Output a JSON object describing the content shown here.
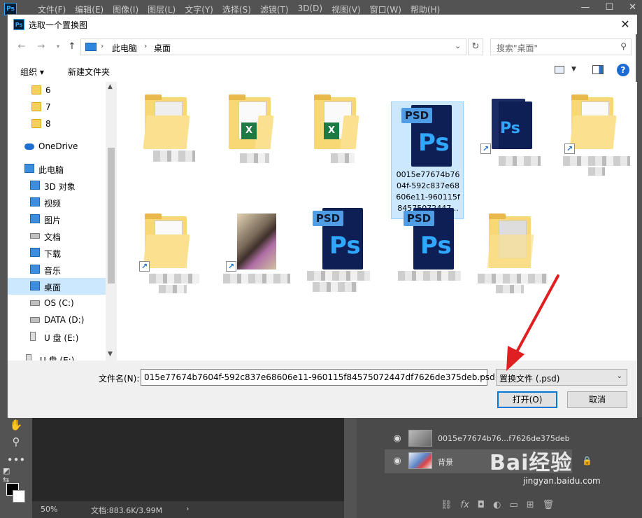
{
  "ps": {
    "logo": "Ps",
    "menu": [
      "文件(F)",
      "编辑(E)",
      "图像(I)",
      "图层(L)",
      "文字(Y)",
      "选择(S)",
      "滤镜(T)",
      "3D(D)",
      "视图(V)",
      "窗口(W)",
      "帮助(H)"
    ],
    "status": {
      "zoom": "50%",
      "doc": "文档:883.6K/3.99M",
      "arrow": "›"
    },
    "layers": [
      {
        "name": "0015e77674b76...f7626de375deb"
      },
      {
        "name": "背景"
      }
    ]
  },
  "dialog": {
    "title": "选取一个置换图",
    "close": "✕",
    "breadcrumb": [
      "此电脑",
      "桌面"
    ],
    "search_placeholder": "搜索\"桌面\"",
    "toolbar": {
      "organize": "组织 ▾",
      "new_folder": "新建文件夹",
      "help": "?"
    },
    "nav_items": [
      {
        "label": "6",
        "icon": "folder-icon"
      },
      {
        "label": "7",
        "icon": "folder-icon"
      },
      {
        "label": "8",
        "icon": "folder-icon"
      },
      {
        "label": "OneDrive",
        "icon": "cloud-icon"
      },
      {
        "label": "此电脑",
        "icon": "computer-icon"
      },
      {
        "label": "3D 对象",
        "icon": "3d-objects-icon"
      },
      {
        "label": "视频",
        "icon": "video-icon"
      },
      {
        "label": "图片",
        "icon": "pictures-icon"
      },
      {
        "label": "文档",
        "icon": "documents-icon"
      },
      {
        "label": "下载",
        "icon": "download-icon"
      },
      {
        "label": "音乐",
        "icon": "music-icon"
      },
      {
        "label": "桌面",
        "icon": "desktop-icon"
      },
      {
        "label": "OS (C:)",
        "icon": "drive-icon"
      },
      {
        "label": "DATA (D:)",
        "icon": "drive-icon"
      },
      {
        "label": "U 盘 (E:)",
        "icon": "usb-drive-icon"
      },
      {
        "label": "U 盘 (E:)",
        "icon": "usb-drive-icon"
      }
    ],
    "selected_file_caption": "0015e77674b7604f-592c837e68606e11-960115f84575072447...",
    "psd_label": "PSD",
    "ps_label": "Ps",
    "excel_label": "X",
    "filename_label": "文件名(N):",
    "filename_value": "015e77674b7604f-592c837e68606e11-960115f84575072447df7626de375deb.psd",
    "filetype_value": "置换文件 (.psd)",
    "open_button": "打开(O)",
    "cancel_button": "取消"
  },
  "watermark": {
    "main": "Bai经验",
    "sub": "jingyan.baidu.com"
  }
}
